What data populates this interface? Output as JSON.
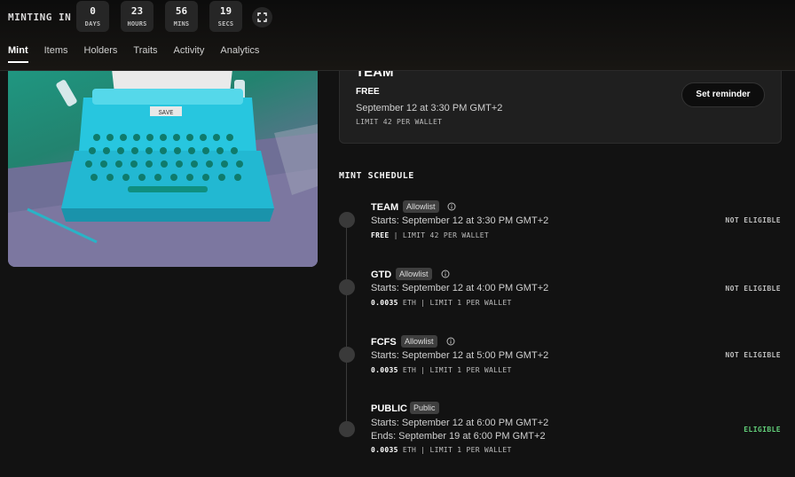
{
  "countdown": {
    "label": "MINTING IN",
    "units": [
      {
        "value": "0",
        "label": "DAYS"
      },
      {
        "value": "23",
        "label": "HOURS"
      },
      {
        "value": "56",
        "label": "MINS"
      },
      {
        "value": "19",
        "label": "SECS"
      }
    ],
    "expand_icon": "expand-icon"
  },
  "tabs": [
    "Mint",
    "Items",
    "Holders",
    "Traits",
    "Activity",
    "Analytics"
  ],
  "active_tab": "Mint",
  "stage_card": {
    "title": "TEAM",
    "price": "FREE",
    "date": "September 12 at 3:30 PM GMT+2",
    "limit": "LIMIT 42 PER WALLET",
    "reminder_label": "Set reminder"
  },
  "schedule": {
    "title": "MINT SCHEDULE",
    "phases": [
      {
        "name": "TEAM",
        "badge": "Allowlist",
        "starts": "Starts: September 12 at 3:30 PM GMT+2",
        "ends": "",
        "price": "FREE",
        "limit": "| LIMIT 42 PER WALLET",
        "status": "NOT ELIGIBLE"
      },
      {
        "name": "GTD",
        "badge": "Allowlist",
        "starts": "Starts: September 12 at 4:00 PM GMT+2",
        "ends": "",
        "price": "0.0035",
        "limit": "ETH | LIMIT 1 PER WALLET",
        "status": "NOT ELIGIBLE"
      },
      {
        "name": "FCFS",
        "badge": "Allowlist",
        "starts": "Starts: September 12 at 5:00 PM GMT+2",
        "ends": "",
        "price": "0.0035",
        "limit": "ETH | LIMIT 1 PER WALLET",
        "status": "NOT ELIGIBLE"
      },
      {
        "name": "PUBLIC",
        "badge": "Public",
        "starts": "Starts: September 12 at 6:00 PM GMT+2",
        "ends": "Ends: September 19 at 6:00 PM GMT+2",
        "price": "0.0035",
        "limit": "ETH | LIMIT 1 PER WALLET",
        "status": "ELIGIBLE"
      }
    ]
  },
  "artwork": {
    "label": "SAVE"
  },
  "colors": {
    "eligible": "#62d07a",
    "background": "#121212",
    "accent": "#22c4e0"
  }
}
